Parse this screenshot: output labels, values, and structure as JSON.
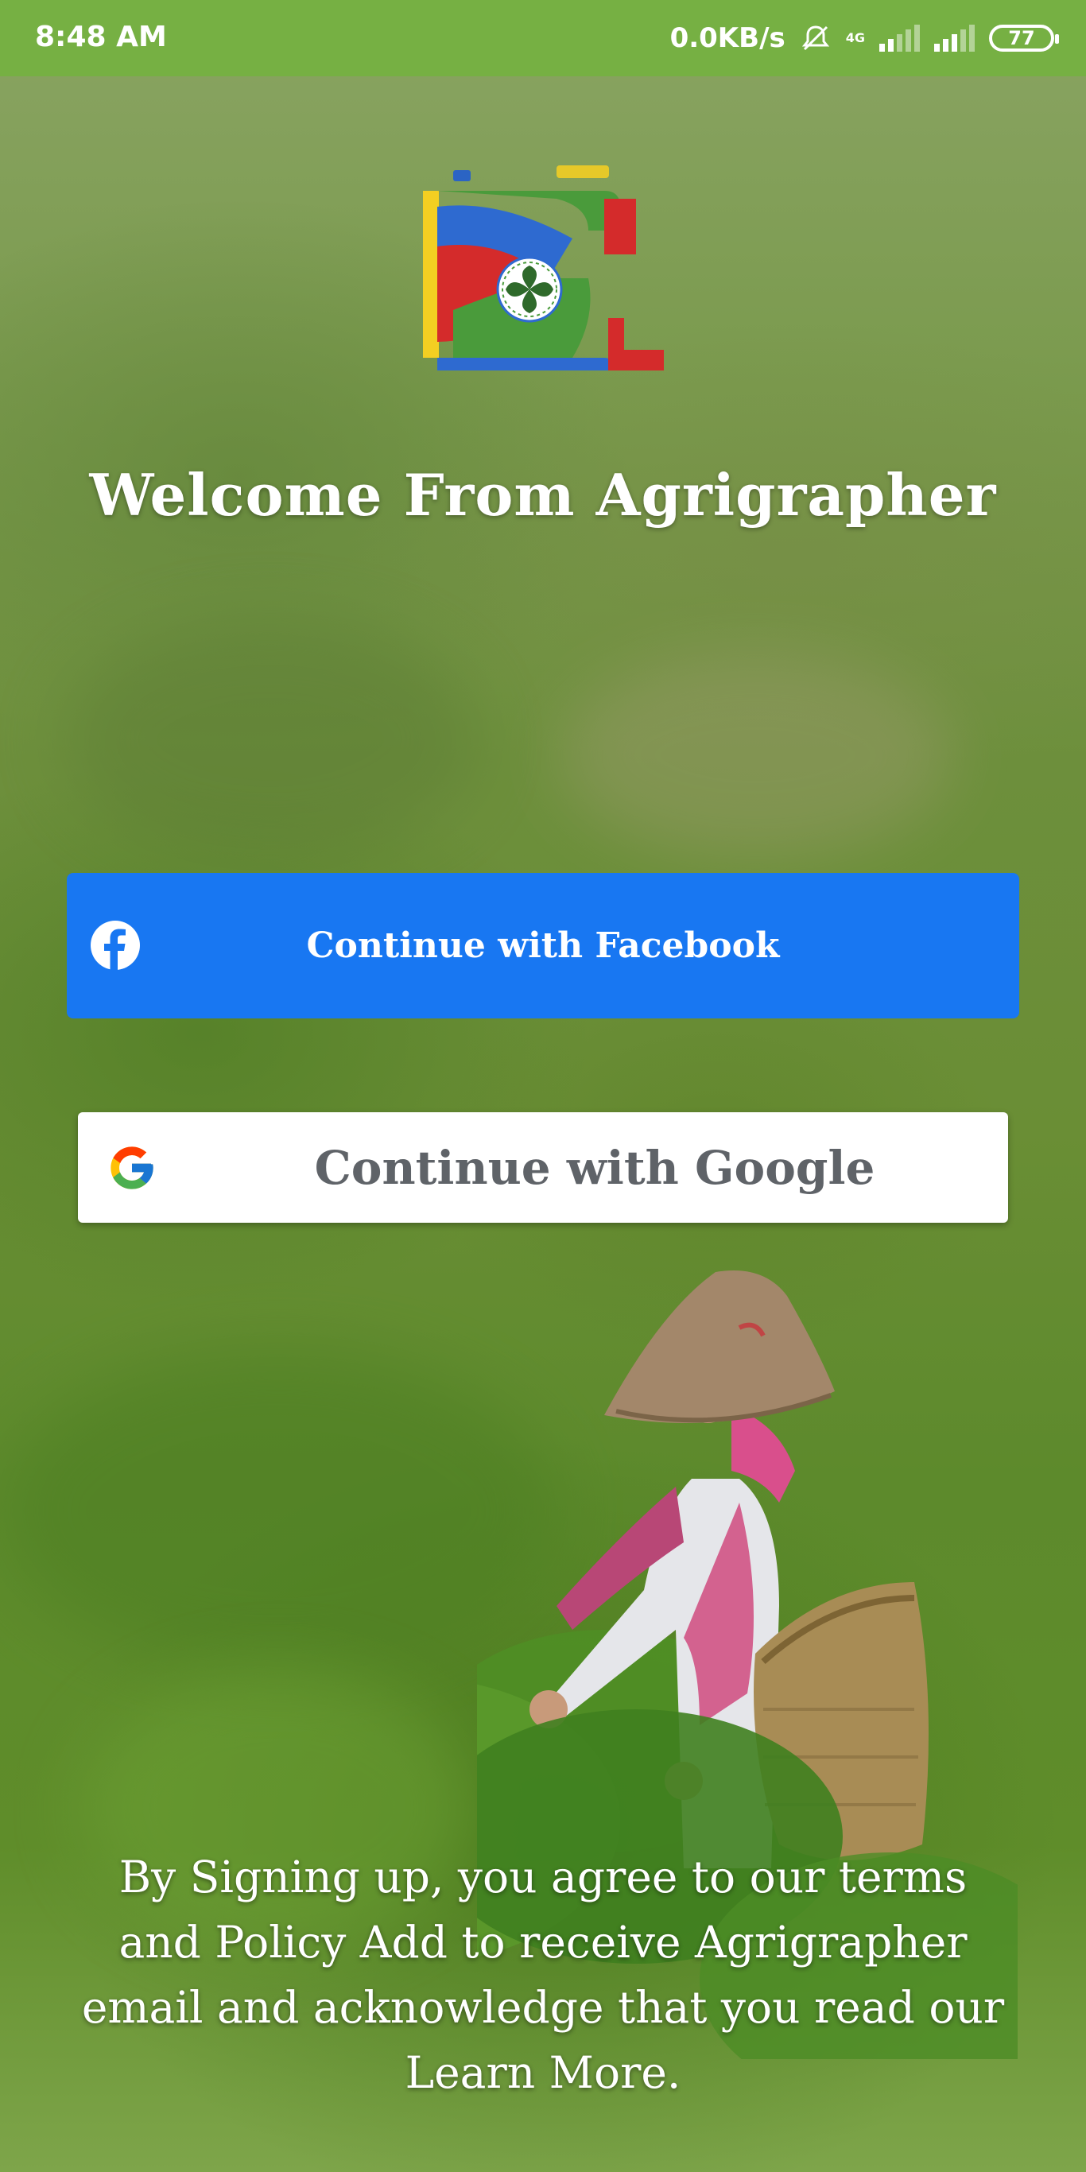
{
  "status_bar": {
    "time": "8:48 AM",
    "network_speed": "0.0KB/s",
    "network_type": "4G",
    "battery": "77",
    "icons": [
      "mute-icon",
      "signal-icon",
      "signal-icon",
      "battery-icon"
    ],
    "color": "#76b043"
  },
  "app": {
    "logo_icon": "agrigrapher-logo",
    "welcome_title": "Welcome From Agrigrapher"
  },
  "login": {
    "facebook_label": "Continue with Facebook",
    "facebook_icon": "facebook-icon",
    "facebook_color": "#1877f2",
    "google_label": "Continue with Google",
    "google_icon": "google-icon"
  },
  "footer": {
    "terms_text": "By Signing up, you agree to our terms and Policy Add to receive Agrigrapher email and acknowledge that you read our Learn More."
  }
}
